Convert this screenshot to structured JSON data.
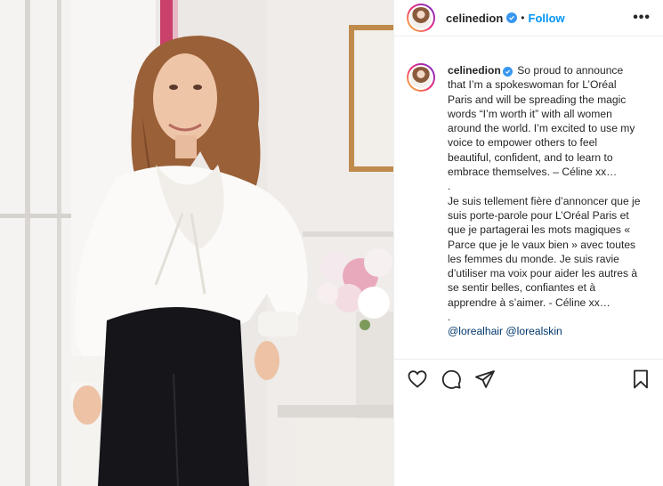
{
  "post": {
    "username": "celinedion",
    "separator": "•",
    "follow_label": "Follow",
    "more_label": "•••"
  },
  "caption": {
    "author": "celinedion",
    "para1": "So proud to announce that I’m a spokeswoman for L’Oréal Paris and will be spreading the magic words “I’m worth it” with all women around the world. I’m excited to use my voice to empower others to feel beautiful, confident, and to learn to embrace themselves. – Céline xx…",
    "dot1": ".",
    "para2": "Je suis tellement fière d’annoncer que je suis porte-parole pour L’Oréal Paris et que je partagerai les mots magiques « Parce que je le vaux bien » avec toutes les femmes du monde. Je suis ravie d’utiliser ma voix pour aider les autres à se sentir belles, confiantes et à apprendre à s’aimer. - Céline xx…",
    "dot2": ".",
    "tag1": "@lorealhair",
    "tag2": "@lorealskin"
  },
  "icons": {
    "like": "heart-icon",
    "comment": "comment-icon",
    "share": "paper-plane-icon",
    "save": "bookmark-icon",
    "verified": "verified-badge-icon"
  },
  "colors": {
    "link": "#0095f6",
    "tag": "#00376b",
    "verified": "#3897f0",
    "text": "#262626"
  }
}
